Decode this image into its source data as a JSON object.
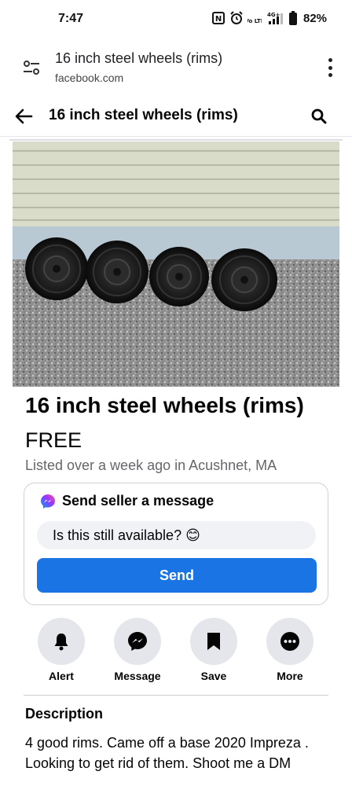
{
  "status_bar": {
    "time": "7:47",
    "nfc_label": "N",
    "volte_label": "Vo LTE",
    "network_label": "4G+",
    "battery_percent": "82%"
  },
  "url_bar": {
    "title": "16 inch steel wheels (rims)",
    "domain": "facebook.com"
  },
  "header": {
    "title": "16 inch steel wheels (rims)"
  },
  "listing": {
    "title": "16 inch steel wheels (rims)",
    "price": "FREE",
    "meta": "Listed over a week ago in Acushnet, MA"
  },
  "message_card": {
    "title": "Send seller a message",
    "input_value": "Is this still available? 😊",
    "send_label": "Send"
  },
  "actions": [
    {
      "label": "Alert",
      "icon": "bell-icon"
    },
    {
      "label": "Message",
      "icon": "messenger-icon"
    },
    {
      "label": "Save",
      "icon": "bookmark-icon"
    },
    {
      "label": "More",
      "icon": "more-icon"
    }
  ],
  "description": {
    "heading": "Description",
    "body": "4 good rims. Came off a base 2020 Impreza . Looking to get rid of them. Shoot me a DM"
  },
  "colors": {
    "primary_blue": "#1b74e4",
    "secondary_gray": "#65676b",
    "button_gray": "#e4e6eb"
  }
}
